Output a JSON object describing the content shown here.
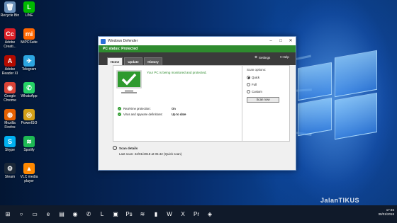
{
  "desktop": {
    "icons": [
      {
        "label": "Recycle Bin",
        "glyph": "🗑",
        "color": "#6a8fb8"
      },
      {
        "label": "LINE",
        "glyph": "L",
        "color": "#00b900"
      },
      {
        "label": "Adobe Creati...",
        "glyph": "Cc",
        "color": "#da1f26"
      },
      {
        "label": "MiPCSuite",
        "glyph": "mi",
        "color": "#ff6700"
      },
      {
        "label": "Adobe Reader XI",
        "glyph": "A",
        "color": "#b30b00"
      },
      {
        "label": "Telegram",
        "glyph": "✈",
        "color": "#2ca5e0"
      },
      {
        "label": "Google Chrome",
        "glyph": "◉",
        "color": "#db4437"
      },
      {
        "label": "WhatsApp",
        "glyph": "✆",
        "color": "#25d366"
      },
      {
        "label": "Mozilla Firefox",
        "glyph": "◍",
        "color": "#e66000"
      },
      {
        "label": "PowerISO",
        "glyph": "◎",
        "color": "#d4a017"
      },
      {
        "label": "Skype",
        "glyph": "S",
        "color": "#00aff0"
      },
      {
        "label": "Spotify",
        "glyph": "≋",
        "color": "#1db954"
      },
      {
        "label": "Steam",
        "glyph": "⚙",
        "color": "#1b2838"
      },
      {
        "label": "VLC media player",
        "glyph": "▲",
        "color": "#ff8800"
      }
    ]
  },
  "window": {
    "title": "Windows Defender",
    "status": "PC status: Protected",
    "tabs": [
      "Home",
      "Update",
      "History"
    ],
    "settings_label": "Settings",
    "help_label": "▾ Help",
    "message": "Your PC is being monitored and protected.",
    "protection": [
      {
        "label": "Real-time protection:",
        "value": "On"
      },
      {
        "label": "Virus and spyware definitions:",
        "value": "Up to date"
      }
    ],
    "scan_options": {
      "title": "Scan options:",
      "options": [
        "Quick",
        "Full",
        "Custom"
      ],
      "selected": "Quick",
      "button": "Scan now"
    },
    "scan_details": {
      "title": "Scan details",
      "last_scan": "Last scan: 22/01/2018 at 05.32 (Quick scan)"
    }
  },
  "taskbar": {
    "items": [
      "start-icon",
      "search-icon",
      "task-view-icon",
      "edge-icon",
      "explorer-icon",
      "chrome-icon",
      "whatsapp-icon",
      "line-icon",
      "store-icon",
      "photoshop-icon",
      "spotify-icon",
      "terminal-icon",
      "word-icon",
      "excel-icon",
      "premiere-icon",
      "defender-icon"
    ],
    "time": "17:45",
    "date": "30/01/2018"
  },
  "watermark": "JalanTIKUS"
}
